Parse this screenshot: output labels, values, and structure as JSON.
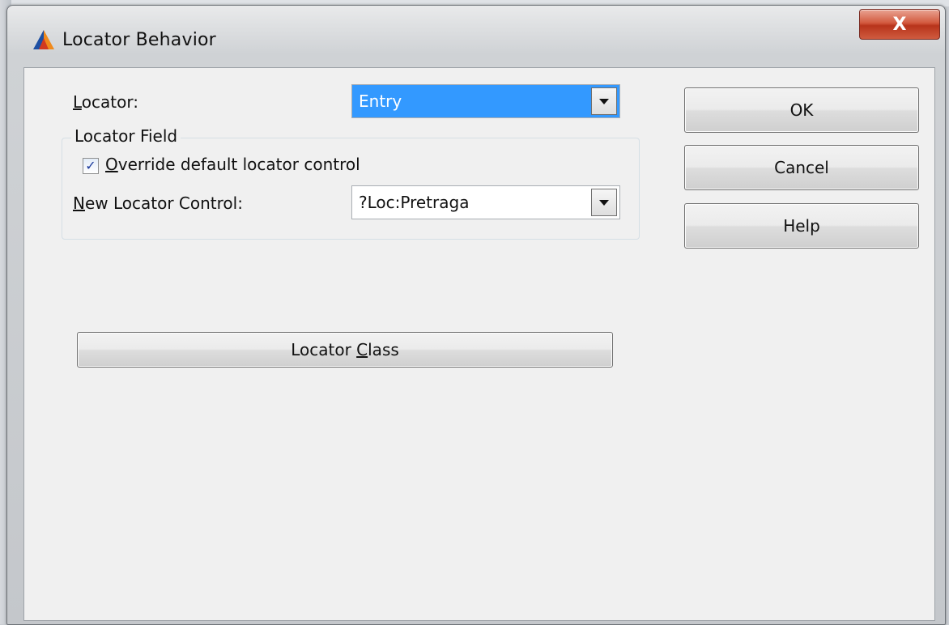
{
  "window": {
    "title": "Locator Behavior",
    "close_glyph": "X"
  },
  "form": {
    "locator_label_first": "L",
    "locator_label_rest": "ocator:",
    "locator_value": "Entry",
    "group_title": "Locator Field",
    "override_checked": true,
    "override_label_first": "O",
    "override_label_rest": "verride default locator control",
    "new_control_label_first": "N",
    "new_control_label_rest": "ew Locator Control:",
    "new_control_value": "?Loc:Pretraga",
    "locator_class_pre": "Locator ",
    "locator_class_ul": "C",
    "locator_class_post": "lass"
  },
  "buttons": {
    "ok": "OK",
    "cancel": "Cancel",
    "help": "Help"
  },
  "icons": {
    "app": "triangle-logo-icon",
    "close": "close-icon",
    "dropdown": "chevron-down-icon",
    "check": "checkmark-icon"
  },
  "colors": {
    "selection": "#3399ff",
    "close_button": "#c94a30"
  }
}
